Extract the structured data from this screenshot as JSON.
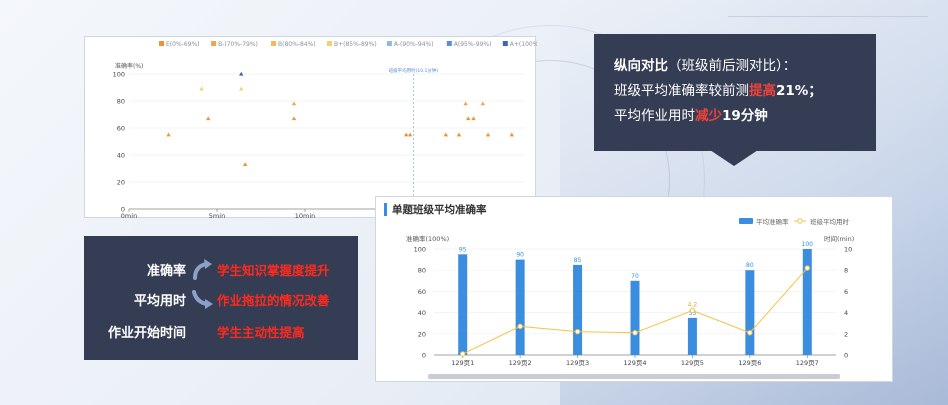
{
  "scatter": {
    "legend": [
      "E(0%-69%)",
      "B-(70%-79%)",
      "B(80%-84%)",
      "B+(85%-89%)",
      "A-(90%-94%)",
      "A(95%-99%)",
      "A+(100%)"
    ],
    "legend_colors": [
      "#f09235",
      "#f4a34e",
      "#f6b85a",
      "#f7cf6e",
      "#8fb6e6",
      "#5a8fd6",
      "#3a66c2"
    ],
    "y_label": "准确率(%)",
    "y_ticks": [
      "0",
      "20",
      "40",
      "60",
      "80",
      "100"
    ],
    "x_ticks": [
      "0min",
      "5min",
      "10min",
      "15min",
      "20min"
    ],
    "avg_line_label": "班级平均用时(10.1分钟)"
  },
  "note": {
    "heading": "纵向对比",
    "heading_sub": "（班级前后测对比）：",
    "line2_pre": "班级平均准确率较前测",
    "line2_red": "提高",
    "line2_post": "21%；",
    "line3_pre": "平均作业用时",
    "line3_red": "减少",
    "line3_post": "19分钟"
  },
  "summary": {
    "rows": [
      {
        "label": "准确率",
        "value": "学生知识掌握度提升",
        "icon": "curved-arrow-up-icon"
      },
      {
        "label": "平均用时",
        "value": "作业拖拉的情况改善",
        "icon": "curved-arrow-down-icon"
      },
      {
        "label": "作业开始时间",
        "value": "学生主动性提高",
        "icon": ""
      }
    ]
  },
  "bar_panel": {
    "title": "单题班级平均准确率",
    "legend_bar": "平均准确率",
    "legend_line": "班级平均用时"
  },
  "colors": {
    "dark_card": "#353d55",
    "emphasis_red": "#f0413b",
    "bar_blue": "#3b8de0",
    "line_yellow": "#f5c342"
  },
  "chart_data": [
    {
      "type": "scatter",
      "xlabel": "",
      "ylabel": "准确率(%)",
      "xlim": [
        0,
        22.5
      ],
      "ylim": [
        0,
        100
      ],
      "x_unit": "min",
      "avg_time_min": 10.1,
      "points": [
        {
          "x": 3.0,
          "y": 55,
          "band": 0
        },
        {
          "x": 6.0,
          "y": 67,
          "band": 0
        },
        {
          "x": 5.5,
          "y": 89,
          "band": 3
        },
        {
          "x": 8.5,
          "y": 89,
          "band": 3
        },
        {
          "x": 8.5,
          "y": 100,
          "band": 6
        },
        {
          "x": 8.8,
          "y": 33,
          "band": 0
        },
        {
          "x": 12.5,
          "y": 78,
          "band": 1
        },
        {
          "x": 12.5,
          "y": 67,
          "band": 0
        },
        {
          "x": 21.0,
          "y": 55,
          "band": 0
        },
        {
          "x": 21.3,
          "y": 55,
          "band": 0
        },
        {
          "x": 24.0,
          "y": 55,
          "band": 0
        },
        {
          "x": 25.0,
          "y": 55,
          "band": 0
        },
        {
          "x": 25.5,
          "y": 78,
          "band": 1
        },
        {
          "x": 25.7,
          "y": 67,
          "band": 0
        },
        {
          "x": 26.1,
          "y": 67,
          "band": 0
        },
        {
          "x": 26.8,
          "y": 78,
          "band": 1
        },
        {
          "x": 27.2,
          "y": 55,
          "band": 0
        },
        {
          "x": 29.0,
          "y": 55,
          "band": 0
        }
      ]
    },
    {
      "type": "bar",
      "categories": [
        "129页1",
        "129页2",
        "129页3",
        "129页4",
        "129页5",
        "129页6",
        "129页7"
      ],
      "y_left_label": "准确率(100%)",
      "y_right_label": "时间(min)",
      "y_left_ticks": [
        "0",
        "20",
        "40",
        "60",
        "80",
        "100"
      ],
      "y_right_ticks": [
        "0",
        "2",
        "4",
        "6",
        "8",
        "10"
      ],
      "ylim_left": [
        0,
        100
      ],
      "ylim_right": [
        0,
        10
      ],
      "series": [
        {
          "name": "平均准确率",
          "kind": "bar",
          "axis": "left",
          "values": [
            95,
            90,
            85,
            70,
            35,
            80,
            100
          ]
        },
        {
          "name": "班级平均用时",
          "kind": "line",
          "axis": "right",
          "values": [
            0.1,
            2.7,
            2.2,
            2.1,
            4.2,
            2.1,
            8.2
          ]
        }
      ],
      "bar_labels": [
        "95",
        "90",
        "85",
        "70",
        "35",
        "80",
        "100"
      ],
      "line_labels": [
        "",
        "",
        "",
        "",
        "4.2",
        "",
        ""
      ]
    }
  ]
}
